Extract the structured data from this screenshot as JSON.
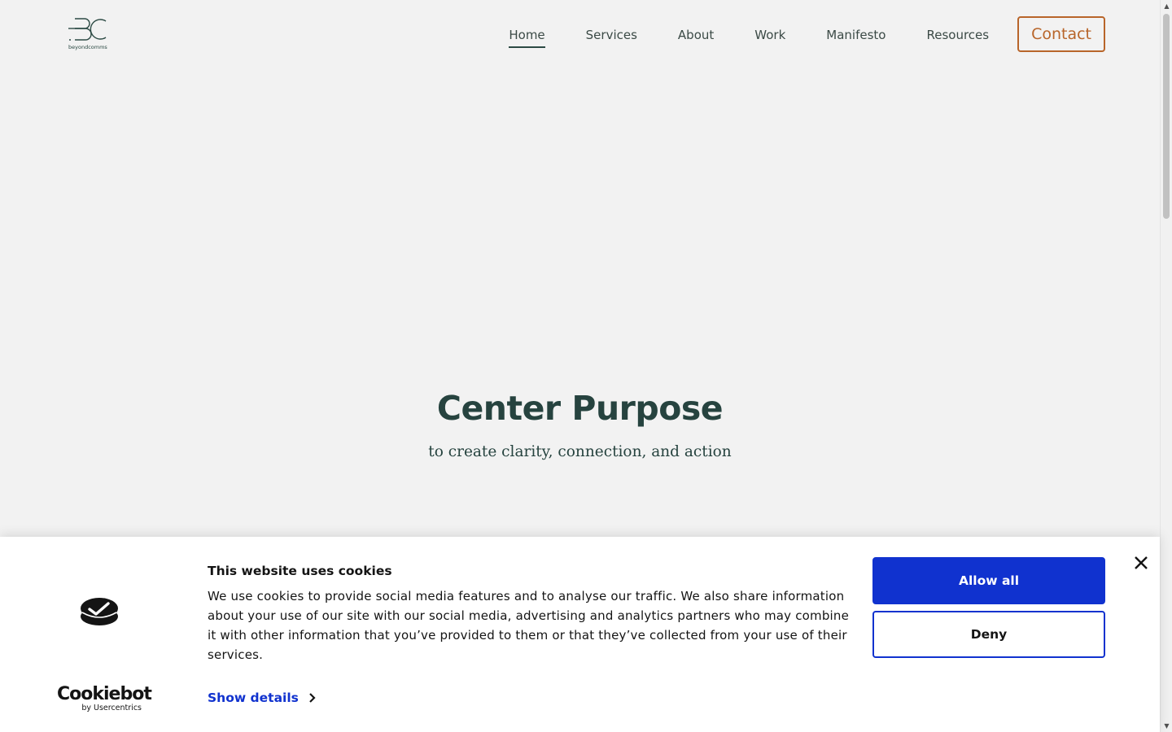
{
  "header": {
    "logo_icon": "beyondcomms-logo",
    "nav": [
      {
        "label": "Home",
        "active": true
      },
      {
        "label": "Services",
        "active": false
      },
      {
        "label": "About",
        "active": false
      },
      {
        "label": "Work",
        "active": false
      },
      {
        "label": "Manifesto",
        "active": false
      },
      {
        "label": "Resources",
        "active": false
      }
    ],
    "contact_label": "Contact",
    "accent_color": "#b8652a"
  },
  "hero": {
    "title": "Center Purpose",
    "subtitle": "to create clarity, connection, and action",
    "text_color": "#26433f"
  },
  "cookie_banner": {
    "title": "This website uses cookies",
    "body": "We use cookies to provide social media features and to analyse our traffic. We also share information about your use of our site with our social media, advertising and analytics partners who may combine it with other information that you’ve provided to them or that they’ve collected from your use of their services.",
    "show_details_label": "Show details",
    "allow_all_label": "Allow all",
    "deny_label": "Deny",
    "brand_name": "Cookiebot",
    "brand_by": "by Usercentrics",
    "brand_color": "#1032cf"
  }
}
